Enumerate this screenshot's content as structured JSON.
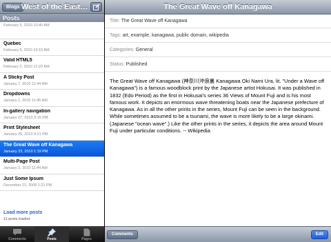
{
  "left_pane": {
    "blogs_button": "Blogs",
    "blog_title": "West of the Easter...",
    "compose_icon": "compose-icon",
    "section_header": "Posts",
    "posts": [
      {
        "title": "",
        "date": "February 5, 2010 10:45 AM",
        "selected": false
      },
      {
        "title": "Quebec",
        "date": "February 5, 2010 10:15 AM",
        "selected": false
      },
      {
        "title": "Valid HTML5",
        "date": "February 2, 2010 12:22 AM",
        "selected": false
      },
      {
        "title": "A Sticky Post",
        "date": "January 7, 2010 11:44 AM",
        "selected": false
      },
      {
        "title": "Dropdowns",
        "date": "January 1, 2010 11:45 AM",
        "selected": false
      },
      {
        "title": "In-gallery navigation",
        "date": "January 27, 2010 9:15 PM",
        "selected": false
      },
      {
        "title": "Print Stylesheet",
        "date": "January 25, 2010 9:21 PM",
        "selected": false
      },
      {
        "title": "The Great Wave off Kanagawa",
        "date": "January 23, 2010 1:19 PM",
        "selected": true
      },
      {
        "title": "Multi-Page Post",
        "date": "January 2, 2010 11:44 AM",
        "selected": false
      },
      {
        "title": "Just Some Ipsum",
        "date": "December 21, 2009 1:21 PM",
        "selected": false
      }
    ],
    "load_more": "Load more posts",
    "loaded_count": "11 posts loaded",
    "tabs": [
      {
        "label": "Comments",
        "icon": "comments-icon",
        "active": false
      },
      {
        "label": "Posts",
        "icon": "pushpin-icon",
        "active": true
      },
      {
        "label": "Pages",
        "icon": "page-icon",
        "active": false
      }
    ]
  },
  "right_pane": {
    "nav_title": "The Great Wave off Kanagawa",
    "fields": {
      "title_label": "Title:",
      "title_value": "The Great Wave off Kanagawa",
      "tags_label": "Tags:",
      "tags_value": "art, example, kanagawa, public domain, wikipedia",
      "categories_label": "Categories:",
      "categories_value": "General",
      "status_label": "Status:",
      "status_value": "Published"
    },
    "body": "The Great Wave off Kanagawa (神奈川沖浪裏 Kanagawa Oki Nami Ura, lit. \"Under a Wave off Kanagawa\") is a famous woodblock print by the Japanese artist Hokusai. It was published in 1832 (Edo Period) as the first in Hokusai's series 36 Views of Mount Fuji and is his most famous work. It depicts an enormous wave threatening boats near the Japanese prefecture of Kanagawa. As in all the other prints in the series, Mount Fuji can be seen in the background. While sometimes assumed to be a tsunami, the wave is more likely to be a large okinami. (Japanese \"ocean wave\".) Like the other prints in the series, it depicts the area around Mount Fuji under particular conditions. -- Wikipedia",
    "comments_button": "Comments",
    "edit_button": "Edit"
  }
}
